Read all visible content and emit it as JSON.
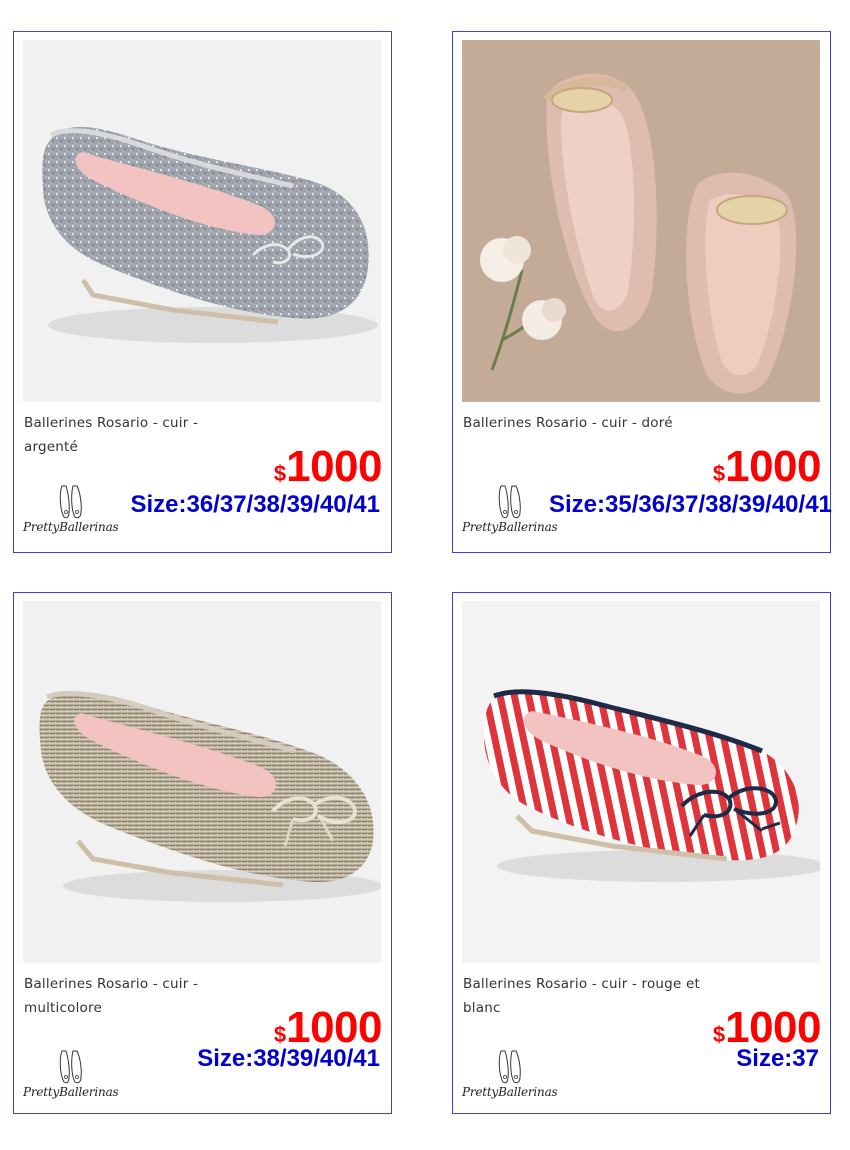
{
  "products": [
    {
      "title": "Ballerines Rosario - cuir - argenté",
      "currency": "$",
      "price": "1000",
      "size": "Size:36/37/38/39/40/41",
      "brand": "PrettyBallerinas",
      "image": "silver-glitter-ballerina-image"
    },
    {
      "title": "Ballerines Rosario - cuir - doré",
      "currency": "$",
      "price": "1000",
      "size": "Size:35/36/37/38/39/40/41",
      "brand": "PrettyBallerinas",
      "image": "gold-rope-bow-ballerinas-image"
    },
    {
      "title": "Ballerines Rosario - cuir - multicolore",
      "currency": "$",
      "price": "1000",
      "size": "Size:38/39/40/41",
      "brand": "PrettyBallerinas",
      "image": "tweed-multicolour-ballerina-image"
    },
    {
      "title": "Ballerines Rosario - cuir - rouge et blanc",
      "currency": "$",
      "price": "1000",
      "size": "Size:37",
      "brand": "PrettyBallerinas",
      "image": "red-white-stripe-ballerina-image"
    }
  ],
  "colors": {
    "border": "#3f3fd8",
    "price": "#ff0000",
    "size": "#0000d0",
    "title": "#333333"
  }
}
